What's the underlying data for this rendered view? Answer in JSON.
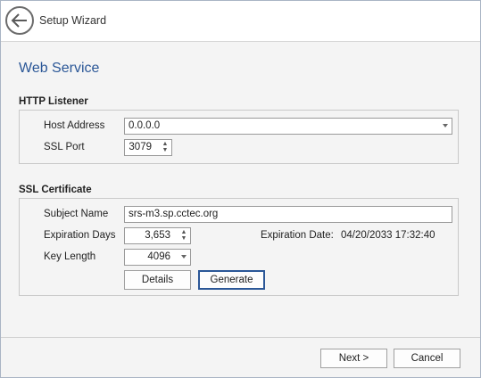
{
  "window": {
    "title": "Setup Wizard"
  },
  "page": {
    "title": "Web Service"
  },
  "http_listener": {
    "section_title": "HTTP Listener",
    "host_address_label": "Host Address",
    "host_address_value": "0.0.0.0",
    "ssl_port_label": "SSL Port",
    "ssl_port_value": "3079"
  },
  "ssl_certificate": {
    "section_title": "SSL Certificate",
    "subject_name_label": "Subject Name",
    "subject_name_value": "srs-m3.sp.cctec.org",
    "expiration_days_label": "Expiration Days",
    "expiration_days_value": "3,653",
    "expiration_date_label": "Expiration Date:",
    "expiration_date_value": "04/20/2033 17:32:40",
    "key_length_label": "Key Length",
    "key_length_value": "4096",
    "details_label": "Details",
    "generate_label": "Generate"
  },
  "footer": {
    "next_label": "Next >",
    "cancel_label": "Cancel"
  },
  "colors": {
    "accent": "#2b5797",
    "background": "#f4f4f4"
  },
  "icons": {
    "back": "back-arrow-icon",
    "spin_up": "spin-up-icon",
    "spin_down": "spin-down-icon",
    "dropdown": "chevron-down-icon"
  }
}
